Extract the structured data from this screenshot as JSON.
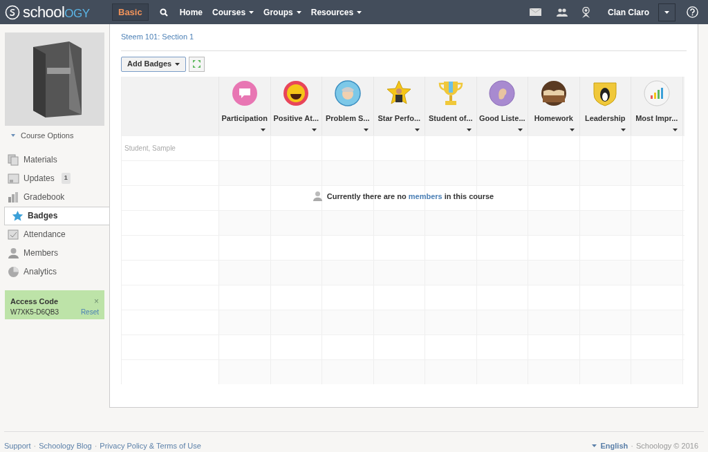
{
  "top_bar": {
    "logo": {
      "main": "school",
      "accent": "OGY"
    },
    "mode_button": "Basic",
    "nav": [
      {
        "label": "Home",
        "dropdown": false
      },
      {
        "label": "Courses",
        "dropdown": true
      },
      {
        "label": "Groups",
        "dropdown": true
      },
      {
        "label": "Resources",
        "dropdown": true
      }
    ],
    "user_name": "Clan Claro"
  },
  "sidebar": {
    "course_options": "Course Options",
    "items": [
      {
        "label": "Materials",
        "selected": false
      },
      {
        "label": "Updates",
        "selected": false,
        "count": "1"
      },
      {
        "label": "Gradebook",
        "selected": false
      },
      {
        "label": "Badges",
        "selected": true
      },
      {
        "label": "Attendance",
        "selected": false
      },
      {
        "label": "Members",
        "selected": false
      },
      {
        "label": "Analytics",
        "selected": false
      }
    ],
    "access_code": {
      "title": "Access Code",
      "close": "×",
      "code": "W7XK5-D6QB3",
      "reset": "Reset"
    }
  },
  "main": {
    "breadcrumb": "Steem 101: Section 1",
    "add_badges_button": "Add Badges",
    "badges": [
      {
        "name": "Participation"
      },
      {
        "name": "Positive At..."
      },
      {
        "name": "Problem S..."
      },
      {
        "name": "Star Perfo..."
      },
      {
        "name": "Student of..."
      },
      {
        "name": "Good Liste..."
      },
      {
        "name": "Homework"
      },
      {
        "name": "Leadership"
      },
      {
        "name": "Most Impr..."
      }
    ],
    "rows": [
      {
        "student": "Student, Sample"
      }
    ],
    "empty_message": {
      "before": "Currently there are no ",
      "link": "members",
      "after": " in this course"
    }
  },
  "footer": {
    "separator": "·",
    "links": [
      "Support",
      "Schoology Blog",
      "Privacy Policy & Terms of Use"
    ],
    "language": "English",
    "copyright": "Schoology © 2016"
  }
}
